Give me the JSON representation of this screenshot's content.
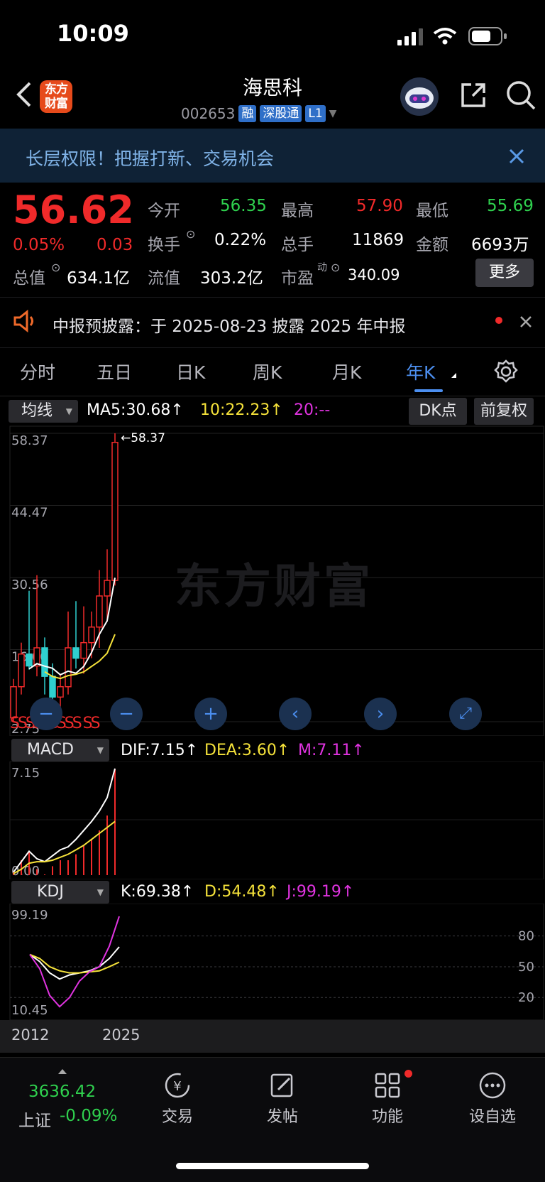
{
  "status_bar": {
    "time": "10:09"
  },
  "header": {
    "logo_text": "东方财富",
    "title": "海思科",
    "code": "002653",
    "tags": [
      "融",
      "深股通",
      "L1"
    ]
  },
  "banner": {
    "text": "长层权限！把握打新、交易机会"
  },
  "quote": {
    "price": "56.62",
    "change_pct": "0.05%",
    "change": "0.03",
    "open_label": "今开",
    "open": "56.35",
    "high_label": "最高",
    "high": "57.90",
    "low_label": "最低",
    "low": "55.69",
    "turnover_label": "换手",
    "turnover": "0.22%",
    "volume_label": "总手",
    "volume": "11869",
    "amount_label": "金额",
    "amount": "6693万",
    "total_value_label": "总值",
    "total_value": "634.1亿",
    "float_value_label": "流值",
    "float_value": "303.2亿",
    "pe_label": "市盈",
    "pe_sup": "动",
    "pe": "340.09",
    "more": "更多"
  },
  "notice": {
    "text": "中报预披露：于 2025-08-23 披露 2025 年中报"
  },
  "tabs": [
    "分时",
    "五日",
    "日K",
    "周K",
    "月K",
    "年K"
  ],
  "active_tab": "年K",
  "main_chart": {
    "indicator": "均线",
    "ma5": "MA5:30.68↑",
    "ma10": "10:22.23↑",
    "ma20": "20:--",
    "dk": "DK点",
    "adjust": "前复权",
    "y_labels": [
      "58.37",
      "44.47",
      "30.56",
      "16.66",
      "2.75"
    ],
    "max_marker": "←58.37",
    "watermark": "东方财富",
    "s_markers": "SSSSSSSSS SS"
  },
  "macd": {
    "indicator": "MACD",
    "dif": "DIF:7.15↑",
    "dea": "DEA:3.60↑",
    "m": "M:7.11↑",
    "y_labels": [
      "7.15",
      "0.00"
    ]
  },
  "kdj": {
    "indicator": "KDJ",
    "k": "K:69.38↑",
    "d": "D:54.48↑",
    "j": "J:99.19↑",
    "y_labels": [
      "99.19",
      "10.45"
    ],
    "right_labels": [
      "80",
      "50",
      "20"
    ]
  },
  "x_axis": [
    "2012",
    "2025"
  ],
  "bottom_bar": {
    "index_value": "3636.42",
    "index_name": "上证",
    "index_change": "-0.09%",
    "items": [
      "交易",
      "发帖",
      "功能",
      "设自选"
    ]
  },
  "colors": {
    "up": "#f02a2a",
    "down": "#2fd04e",
    "accent": "#4c8ff0",
    "ma10": "#f5e23a",
    "m": "#e033e0"
  },
  "chart_data": {
    "type": "candlestick",
    "x": [
      "2012",
      "2013",
      "2014",
      "2015",
      "2016",
      "2017",
      "2018",
      "2019",
      "2020",
      "2021",
      "2022",
      "2023",
      "2024",
      "2025"
    ],
    "candles": [
      {
        "o": 3.5,
        "c": 9.5,
        "h": 11.0,
        "l": 2.75
      },
      {
        "o": 9.5,
        "c": 15.8,
        "h": 18.0,
        "l": 8.0
      },
      {
        "o": 15.8,
        "c": 13.5,
        "h": 28.0,
        "l": 12.8
      },
      {
        "o": 13.5,
        "c": 17.0,
        "h": 31.0,
        "l": 11.5
      },
      {
        "o": 17.0,
        "c": 11.5,
        "h": 19.0,
        "l": 8.0
      },
      {
        "o": 11.5,
        "c": 7.5,
        "h": 14.0,
        "l": 5.0
      },
      {
        "o": 7.5,
        "c": 9.5,
        "h": 12.0,
        "l": 4.5
      },
      {
        "o": 9.5,
        "c": 17.0,
        "h": 24.0,
        "l": 8.0
      },
      {
        "o": 17.0,
        "c": 15.0,
        "h": 26.0,
        "l": 13.0
      },
      {
        "o": 15.0,
        "c": 18.0,
        "h": 25.0,
        "l": 12.0
      },
      {
        "o": 18.0,
        "c": 21.0,
        "h": 24.0,
        "l": 15.0
      },
      {
        "o": 21.0,
        "c": 27.0,
        "h": 32.0,
        "l": 17.0
      },
      {
        "o": 27.0,
        "c": 30.0,
        "h": 36.0,
        "l": 22.0
      },
      {
        "o": 30.0,
        "c": 56.62,
        "h": 58.37,
        "l": 29.0
      }
    ],
    "ylim": [
      2.75,
      58.37
    ]
  }
}
